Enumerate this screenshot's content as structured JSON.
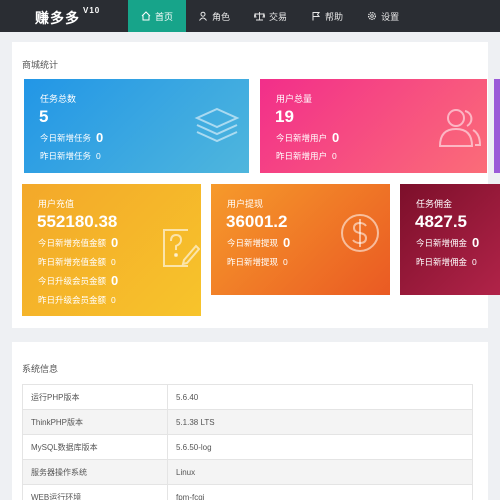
{
  "header": {
    "brand": "赚多多",
    "version": "V10",
    "nav": [
      {
        "label": "首页",
        "icon": "home-icon",
        "active": true
      },
      {
        "label": "角色",
        "icon": "user-icon",
        "active": false
      },
      {
        "label": "交易",
        "icon": "scale-icon",
        "active": false
      },
      {
        "label": "帮助",
        "icon": "flag-icon",
        "active": false
      },
      {
        "label": "设置",
        "icon": "gear-icon",
        "active": false
      }
    ]
  },
  "stats": {
    "title": "商城统计",
    "cards": [
      {
        "title": "任务总数",
        "value": "5",
        "l1": "今日新增任务",
        "v1": "0",
        "l2": "昨日新增任务",
        "v2": "0",
        "icon": "layers-icon"
      },
      {
        "title": "用户总量",
        "value": "19",
        "l1": "今日新增用户",
        "v1": "0",
        "l2": "昨日新增用户",
        "v2": "0",
        "icon": "users-icon"
      },
      {
        "title": "用户充值",
        "value": "552180.38",
        "l1": "今日新增充值金额",
        "v1": "0",
        "l2": "昨日新增充值金额",
        "v2": "0",
        "l3": "今日升级会员金额",
        "v3": "0",
        "l4": "昨日升级会员金额",
        "v4": "0",
        "icon": "edit-note-icon"
      },
      {
        "title": "用户提现",
        "value": "36001.2",
        "l1": "今日新增提现",
        "v1": "0",
        "l2": "昨日新增提现",
        "v2": "0",
        "icon": "dollar-coin-icon"
      },
      {
        "title": "任务佣金",
        "value": "4827.5",
        "l1": "今日新增佣金",
        "v1": "0",
        "l2": "昨日新增佣金",
        "v2": "0"
      }
    ]
  },
  "system": {
    "title": "系统信息",
    "rows": [
      {
        "k": "运行PHP版本",
        "v": "5.6.40"
      },
      {
        "k": "ThinkPHP版本",
        "v": "5.1.38 LTS"
      },
      {
        "k": "MySQL数据库版本",
        "v": "5.6.50-log"
      },
      {
        "k": "服务器操作系统",
        "v": "Linux"
      },
      {
        "k": "WEB运行环境",
        "v": "fpm-fcgi"
      }
    ]
  }
}
